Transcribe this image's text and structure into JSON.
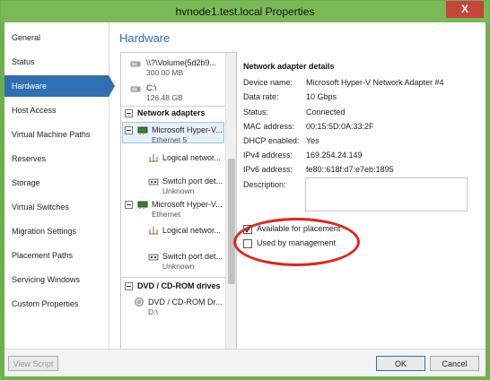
{
  "window": {
    "title": "hvnode1.test.local Properties",
    "close_label": "X"
  },
  "sidebar": {
    "items": [
      {
        "label": "General"
      },
      {
        "label": "Status"
      },
      {
        "label": "Hardware"
      },
      {
        "label": "Host Access"
      },
      {
        "label": "Virtual Machine Paths"
      },
      {
        "label": "Reserves"
      },
      {
        "label": "Storage"
      },
      {
        "label": "Virtual Switches"
      },
      {
        "label": "Migration Settings"
      },
      {
        "label": "Placement Paths"
      },
      {
        "label": "Servicing Windows"
      },
      {
        "label": "Custom Properties"
      }
    ],
    "active_index": 2
  },
  "main": {
    "title": "Hardware",
    "hardware_list": {
      "disk_items": [
        {
          "name": "\\\\?\\Volume{5d2b9...",
          "size": "300.00 MB"
        },
        {
          "name": "C:\\",
          "size": "126.48 GB"
        }
      ],
      "network_section": "Network adapters",
      "adapters": [
        {
          "name": "Microsoft Hyper-V...",
          "sub": "Ethernet 5",
          "logical": "Logical networ...",
          "switch": "Switch port det...",
          "switch_sub": "Unknown"
        },
        {
          "name": "Microsoft Hyper-V...",
          "sub": "Ethernet",
          "logical": "Logical networ...",
          "switch": "Switch port det...",
          "switch_sub": "Unknown"
        }
      ],
      "dvd_section": "DVD / CD-ROM drives",
      "dvd_items": [
        {
          "name": "DVD / CD-ROM Dr...",
          "sub": "D:\\"
        }
      ]
    },
    "details": {
      "title": "Network adapter details",
      "fields": [
        {
          "label": "Device name:",
          "value": "Microsoft Hyper-V Network Adapter #4"
        },
        {
          "label": "Data rate:",
          "value": "10 Gbps"
        },
        {
          "label": "Status:",
          "value": "Connected"
        },
        {
          "label": "MAC address:",
          "value": "00:15:5D:0A:33:2F"
        },
        {
          "label": "DHCP enabled:",
          "value": "Yes"
        },
        {
          "label": "IPv4 address:",
          "value": "169.254.24.149"
        },
        {
          "label": "IPv6 address:",
          "value": "fe80::618f:d7:e7eb:1895"
        }
      ],
      "description_label": "Description:",
      "description_value": "",
      "options": [
        {
          "label": "Available for placement",
          "checked": true
        },
        {
          "label": "Used by management",
          "checked": false
        }
      ]
    }
  },
  "footer": {
    "view_script": "View Script",
    "ok": "OK",
    "cancel": "Cancel"
  }
}
